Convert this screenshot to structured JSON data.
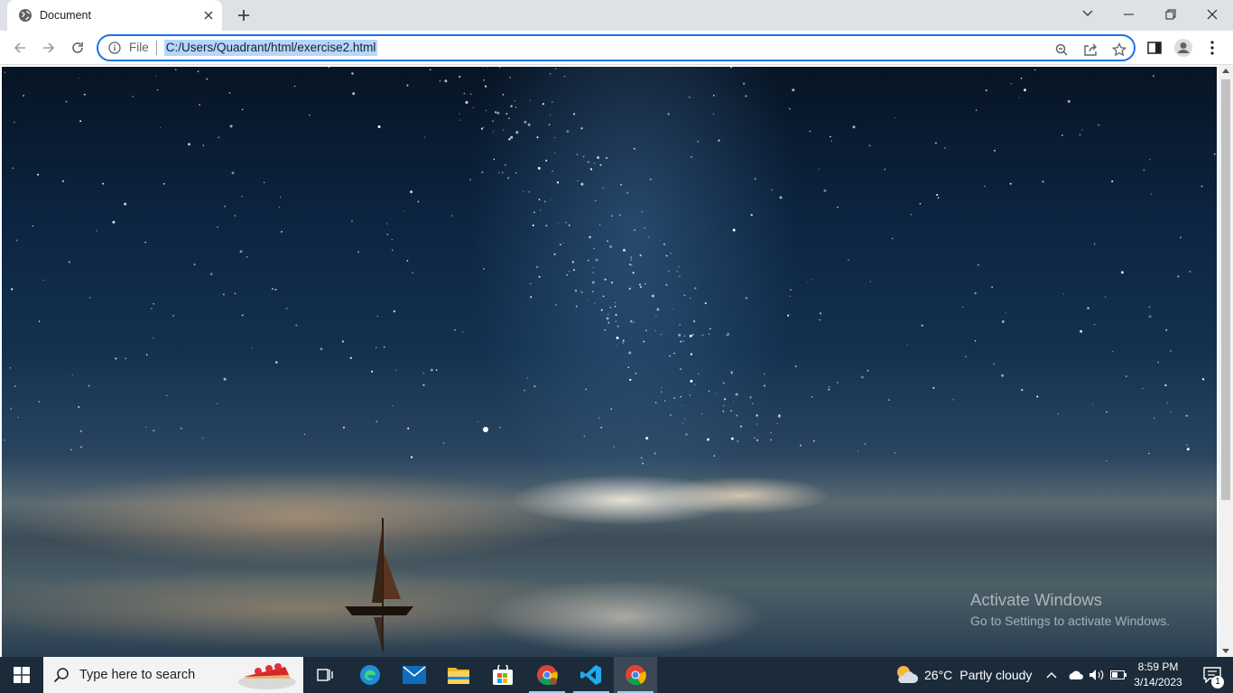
{
  "browser": {
    "tab": {
      "title": "Document"
    },
    "omnibox": {
      "scheme_chip": "File",
      "url": "C:/Users/Quadrant/html/exercise2.html"
    }
  },
  "page": {
    "watermark": {
      "line1": "Activate Windows",
      "line2": "Go to Settings to activate Windows."
    }
  },
  "taskbar": {
    "search_placeholder": "Type here to search",
    "apps": [
      "task-view",
      "edge",
      "mail",
      "file-explorer",
      "microsoft-store",
      "chrome-profile",
      "vscode",
      "chrome"
    ],
    "weather": {
      "temp": "26°C",
      "condition": "Partly cloudy"
    },
    "clock": {
      "time": "8:59 PM",
      "date": "3/14/2023"
    },
    "notifications_count": "1"
  },
  "colors": {
    "accent": "#1a73e8",
    "selection": "#b4d7ff",
    "taskbar": "#1c2b3a"
  }
}
